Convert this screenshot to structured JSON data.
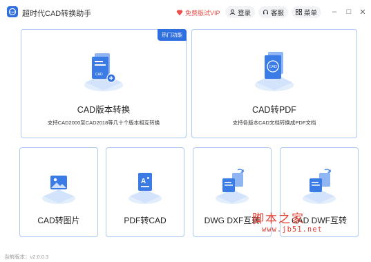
{
  "titlebar": {
    "app_title": "超时代CAD转换助手",
    "vip_label": "免费版试VIP",
    "login_label": "登录",
    "service_label": "客服",
    "menu_label": "菜单",
    "minimize": "–",
    "maximize": "□",
    "close": "✕"
  },
  "cards": {
    "cad_version": {
      "badge": "热门功能",
      "title": "CAD版本转换",
      "desc": "支持CAD2000至CAD2018等几十个版本相互转换"
    },
    "cad_to_pdf": {
      "title": "CAD转PDF",
      "desc": "支持各版本CAD文档转换成PDF文档"
    },
    "cad_to_image": {
      "title": "CAD转图片"
    },
    "pdf_to_cad": {
      "title": "PDF转CAD"
    },
    "dwg_dxf": {
      "title": "DWG DXF互转"
    },
    "cad_dwf": {
      "title": "CAD DWF互转"
    }
  },
  "footer": {
    "version": "当前版本：v2.0.0.3"
  },
  "watermark": {
    "text": "脚本之家",
    "url": "www.jb51.net"
  },
  "colors": {
    "accent": "#2f6fe0",
    "card_border": "#a9c8f3",
    "vip": "#e8524a",
    "watermark": "#e23b2e"
  }
}
